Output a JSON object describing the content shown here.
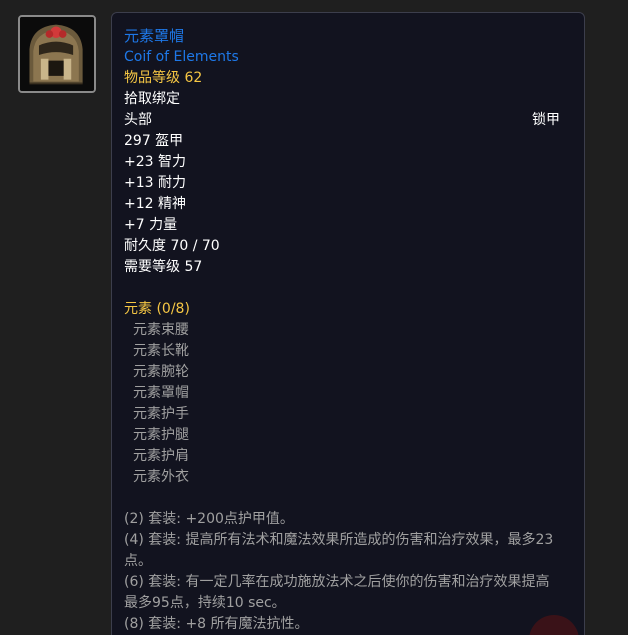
{
  "item": {
    "icon": "leather-coif-helmet-icon",
    "name": "元素罩帽",
    "name_en": "Coif of Elements",
    "item_level": "物品等级 62",
    "binding": "拾取绑定",
    "slot": "头部",
    "armor_type": "锁甲",
    "armor": "297 盔甲",
    "stats": [
      "+23 智力",
      "+13 耐力",
      "+12 精神",
      "+7 力量"
    ],
    "durability": "耐久度 70 / 70",
    "required_level": "需要等级 57"
  },
  "set": {
    "title": "元素 (0/8)",
    "pieces": [
      "元素束腰",
      "元素长靴",
      "元素腕轮",
      "元素罩帽",
      "元素护手",
      "元素护腿",
      "元素护肩",
      "元素外衣"
    ],
    "bonuses": [
      "(2) 套装: +200点护甲值。",
      "(4) 套装: 提高所有法术和魔法效果所造成的伤害和治疗效果，最多23点。",
      "(6) 套装: 有一定几率在成功施放法术之后使你的伤害和治疗效果提高最多95点，持续10 sec。",
      "(8) 套装: +8 所有魔法抗性。"
    ]
  },
  "colors": {
    "item_name": "#1e78e8",
    "item_level": "#f6c744",
    "set_title": "#f6c744",
    "inactive_text": "#a0a0a0",
    "tooltip_bg": "#12131f",
    "page_bg": "#1f1f1f"
  }
}
